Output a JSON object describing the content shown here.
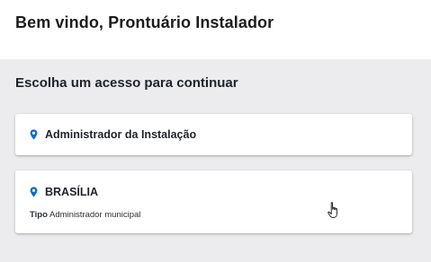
{
  "header": {
    "greeting": "Bem vindo, Prontuário Instalador"
  },
  "access_panel": {
    "title": "Escolha um acesso para continuar",
    "accent_color": "#0a6fc9",
    "options": [
      {
        "name": "Administrador da Instalação",
        "icon": "map-pin-icon"
      },
      {
        "name": "BRASÍLIA",
        "icon": "map-pin-icon",
        "type_label": "Tipo",
        "type_value": "Administrador municipal"
      }
    ]
  },
  "cursor": {
    "icon": "hand-pointer-cursor-icon"
  }
}
